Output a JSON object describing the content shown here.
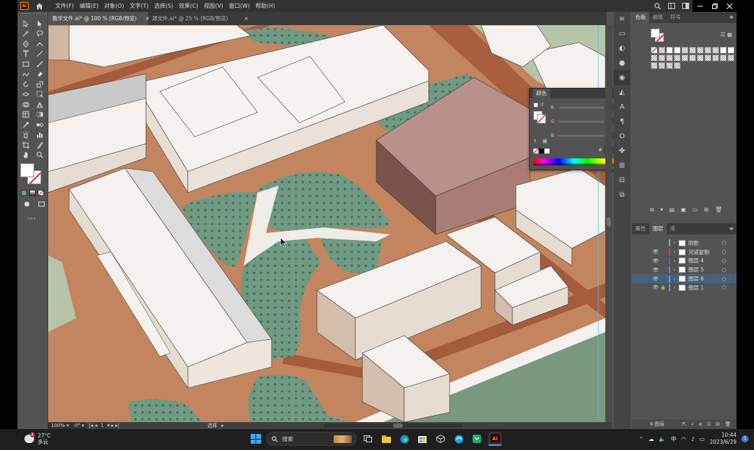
{
  "app": {
    "logo": "Ai",
    "menu": [
      "文件(F)",
      "编辑(E)",
      "对象(O)",
      "文字(T)",
      "选择(S)",
      "效果(C)",
      "视图(V)",
      "窗口(W)",
      "帮助(H)"
    ]
  },
  "tabs": [
    {
      "label": "教学文件.ai* @ 100 % (RGB/预览)",
      "active": true
    },
    {
      "label": "源文件.ai* @ 25 % (RGB/预览)",
      "active": false
    }
  ],
  "swatches_panel": {
    "tabs": [
      "色板",
      "画笔",
      "符号"
    ]
  },
  "color_panel": {
    "title": "颜色",
    "channels": [
      "R",
      "G",
      "B"
    ],
    "hex_label": "#"
  },
  "layers_panel": {
    "tabs": [
      "属性",
      "图层",
      "库"
    ],
    "layers": [
      {
        "name": "阴影",
        "color": "#4bd04b",
        "visible": false,
        "locked": false,
        "selected": false
      },
      {
        "name": "河道复制",
        "color": "#e04040",
        "visible": true,
        "locked": false,
        "selected": false
      },
      {
        "name": "图层 4",
        "color": "#5060e0",
        "visible": true,
        "locked": false,
        "selected": false
      },
      {
        "name": "图层 5",
        "color": "#d050d0",
        "visible": true,
        "locked": false,
        "selected": false
      },
      {
        "name": "图层 6",
        "color": "#40a8f0",
        "visible": true,
        "locked": false,
        "selected": true
      },
      {
        "name": "图层 1",
        "color": "#40a8f0",
        "visible": true,
        "locked": true,
        "selected": false
      }
    ],
    "count": "6 图层"
  },
  "statusbar": {
    "zoom": "100%",
    "rotation": "0°",
    "artboard": "1",
    "tool": "选择"
  },
  "taskbar": {
    "temperature": "27°C",
    "weather": "多云",
    "search_placeholder": "搜索",
    "ime": "中",
    "time": "10:44",
    "date": "2023/6/29",
    "notification_badge": "1"
  },
  "colors": {
    "ground": "#c2855f",
    "road": "#a55b3c",
    "green": "#6f9a83",
    "roof": "#f4f1ee",
    "accent_building": "#b8918a"
  }
}
